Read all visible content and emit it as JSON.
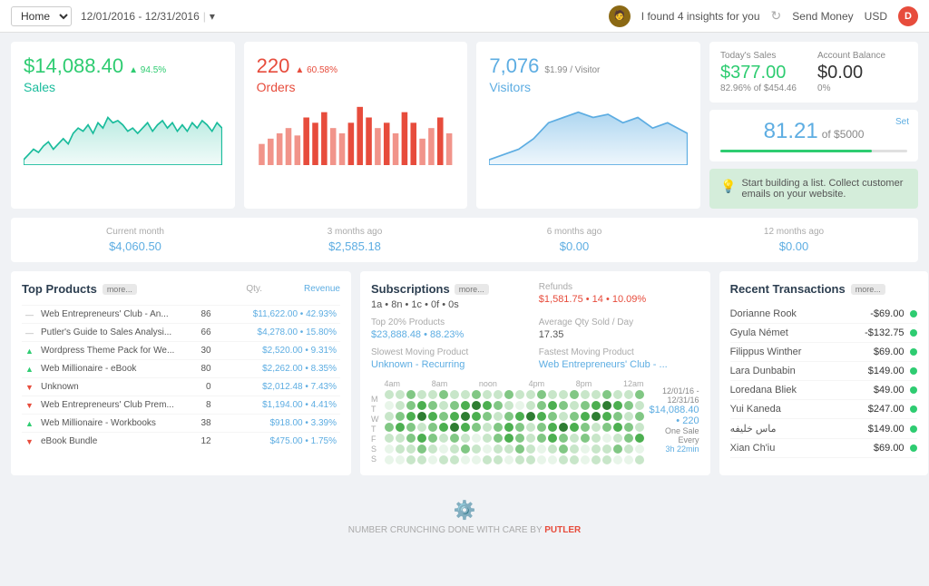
{
  "header": {
    "home_label": "Home",
    "date_range": "12/01/2016 - 12/31/2016",
    "insights_text": "I found 4 insights for you",
    "send_money": "Send Money",
    "currency": "USD",
    "user_initial": "D"
  },
  "metrics": {
    "sales": {
      "value": "$14,088.40",
      "trend": "94.5%",
      "label": "Sales"
    },
    "orders": {
      "value": "220",
      "trend": "60.58%",
      "label": "Orders"
    },
    "visitors": {
      "value": "7,076",
      "sub": "$1.99 / Visitor",
      "label": "Visitors"
    }
  },
  "right_panel": {
    "today_sales_label": "Today's Sales",
    "account_balance_label": "Account Balance",
    "today_sales_value": "$377.00",
    "today_sales_sub": "82.96% of $454.46",
    "account_balance_value": "$0.00",
    "account_balance_sub": "0%",
    "goal_percent": "81.21",
    "goal_of": "of $5000",
    "goal_set": "Set",
    "goal_fill_pct": 81,
    "cta_text": "Start building a list. Collect customer emails on your website."
  },
  "periods": [
    {
      "label": "Current month",
      "value": "$4,060.50"
    },
    {
      "label": "3 months ago",
      "value": "$2,585.18"
    },
    {
      "label": "6 months ago",
      "value": "$0.00"
    },
    {
      "label": "12 months ago",
      "value": "$0.00"
    }
  ],
  "products": {
    "title": "Top Products",
    "more": "more...",
    "col_qty": "Qty.",
    "col_revenue": "Revenue",
    "items": [
      {
        "trend": "dash",
        "name": "Web Entrepreneurs' Club - An...",
        "qty": "86",
        "revenue": "$11,622.00 • 42.93%"
      },
      {
        "trend": "dash",
        "name": "Putler's Guide to Sales Analysi...",
        "qty": "66",
        "revenue": "$4,278.00 • 15.80%"
      },
      {
        "trend": "up",
        "name": "Wordpress Theme Pack for We...",
        "qty": "30",
        "revenue": "$2,520.00 • 9.31%"
      },
      {
        "trend": "up",
        "name": "Web Millionaire - eBook",
        "qty": "80",
        "revenue": "$2,262.00 • 8.35%"
      },
      {
        "trend": "down",
        "name": "Unknown",
        "qty": "0",
        "revenue": "$2,012.48 • 7.43%"
      },
      {
        "trend": "down",
        "name": "Web Entrepreneurs' Club Prem...",
        "qty": "8",
        "revenue": "$1,194.00 • 4.41%"
      },
      {
        "trend": "up",
        "name": "Web Millionaire - Workbooks",
        "qty": "38",
        "revenue": "$918.00 • 3.39%"
      },
      {
        "trend": "down",
        "name": "eBook Bundle",
        "qty": "12",
        "revenue": "$475.00 • 1.75%"
      }
    ]
  },
  "middle": {
    "subscriptions_label": "Subscriptions",
    "subscriptions_more": "more...",
    "subscriptions_value": "1a • 8n • 1c • 0f • 0s",
    "refunds_label": "Refunds",
    "refunds_value": "$1,581.75 • 14 • 10.09%",
    "top20_label": "Top 20% Products",
    "top20_value": "$23,888.48 • 88.23%",
    "avg_qty_label": "Average Qty Sold / Day",
    "avg_qty_value": "17.35",
    "slowest_label": "Slowest Moving Product",
    "slowest_value": "Unknown - Recurring",
    "fastest_label": "Fastest Moving Product",
    "fastest_value": "Web Entrepreneurs' Club - ...",
    "heatmap_hours": [
      "4am",
      "8am",
      "noon",
      "4pm",
      "8pm",
      "12am"
    ],
    "heatmap_days": [
      "M",
      "T",
      "W",
      "T",
      "F",
      "S",
      "S"
    ],
    "date_range_label": "12/01/16 - 12/31/16",
    "total_label": "$14,088.40 • 220",
    "one_sale_label": "One Sale Every",
    "interval_label": "3h 22min"
  },
  "transactions": {
    "title": "Recent Transactions",
    "more": "more...",
    "items": [
      {
        "name": "Dorianne Rook",
        "amount": "-$69.00"
      },
      {
        "name": "Gyula Német",
        "amount": "-$132.75"
      },
      {
        "name": "Filippus Winther",
        "amount": "$69.00"
      },
      {
        "name": "Lara Dunbabin",
        "amount": "$149.00"
      },
      {
        "name": "Loredana Bliek",
        "amount": "$49.00"
      },
      {
        "name": "Yui Kaneda",
        "amount": "$247.00"
      },
      {
        "name": "ماس خليفه",
        "amount": "$149.00"
      },
      {
        "name": "Xian Ch'iu",
        "amount": "$69.00"
      }
    ]
  },
  "footer": {
    "text": "NUMBER CRUNCHING DONE WITH CARE BY",
    "brand": "PUTLER"
  }
}
